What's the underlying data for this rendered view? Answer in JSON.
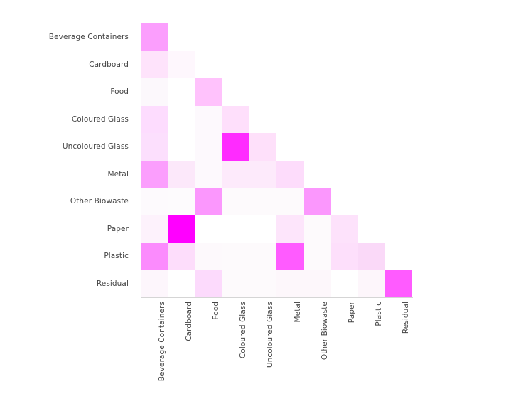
{
  "chart_data": {
    "type": "heatmap",
    "title": "",
    "xlabel": "",
    "ylabel": "",
    "grid": false,
    "legend": "none",
    "triangular": "lower",
    "colorscale": {
      "low": "#ffffff",
      "high": "#ff00ff",
      "name": "white-to-magenta"
    },
    "zmin": 0,
    "zmax": 100,
    "categories": [
      "Beverage Containers",
      "Cardboard",
      "Food",
      "Coloured Glass",
      "Uncoloured Glass",
      "Metal",
      "Other Biowaste",
      "Paper",
      "Plastic",
      "Residual"
    ],
    "x_tick_labels": [
      "Beverage Containers",
      "Cardboard",
      "Food",
      "Coloured Glass",
      "Uncoloured Glass",
      "Metal",
      "Other Biowaste",
      "Paper",
      "Plastic",
      "Residual"
    ],
    "y_tick_labels": [
      "Beverage Containers",
      "Cardboard",
      "Food",
      "Coloured Glass",
      "Uncoloured Glass",
      "Metal",
      "Other Biowaste",
      "Paper",
      "Plastic",
      "Residual"
    ],
    "rows": [
      {
        "label": "Beverage Containers",
        "values": [
          38,
          null,
          null,
          null,
          null,
          null,
          null,
          null,
          null,
          null
        ]
      },
      {
        "label": "Cardboard",
        "values": [
          11,
          3,
          null,
          null,
          null,
          null,
          null,
          null,
          null,
          null
        ]
      },
      {
        "label": "Food",
        "values": [
          3,
          0,
          24,
          null,
          null,
          null,
          null,
          null,
          null,
          null
        ]
      },
      {
        "label": "Coloured Glass",
        "values": [
          14,
          0,
          2,
          13,
          null,
          null,
          null,
          null,
          null,
          null
        ]
      },
      {
        "label": "Uncoloured Glass",
        "values": [
          13,
          0,
          2,
          83,
          12,
          null,
          null,
          null,
          null,
          null
        ]
      },
      {
        "label": "Metal",
        "values": [
          38,
          9,
          2,
          8,
          8,
          14,
          null,
          null,
          null,
          null
        ]
      },
      {
        "label": "Other Biowaste",
        "values": [
          3,
          2,
          40,
          3,
          3,
          3,
          41,
          null,
          null,
          null
        ]
      },
      {
        "label": "Paper",
        "values": [
          4,
          100,
          0,
          0,
          0,
          10,
          2,
          12,
          null,
          null
        ]
      },
      {
        "label": "Plastic",
        "values": [
          45,
          13,
          2,
          2,
          2,
          62,
          2,
          11,
          15,
          null
        ]
      },
      {
        "label": "Residual",
        "values": [
          3,
          0,
          15,
          2,
          2,
          3,
          3,
          0,
          3,
          64
        ]
      }
    ],
    "cell_colors": [
      [
        "#fb9efd",
        null,
        null,
        null,
        null,
        null,
        null,
        null,
        null,
        null
      ],
      [
        "#fee3fb",
        "#fef7fd",
        null,
        null,
        null,
        null,
        null,
        null,
        null,
        null
      ],
      [
        "#fcf8fc",
        "#ffffff",
        "#ffc2fc",
        null,
        null,
        null,
        null,
        null,
        null,
        null
      ],
      [
        "#fddcfe",
        "#ffffff",
        "#fdf9fd",
        "#fedffb",
        null,
        null,
        null,
        null,
        null,
        null
      ],
      [
        "#fcdffd",
        "#ffffff",
        "#fdf9fd",
        "#ff2bff",
        "#fee0fa",
        null,
        null,
        null,
        null,
        null
      ],
      [
        "#fb9efd",
        "#fce8fa",
        "#fdf9fd",
        "#fdeafb",
        "#fdeafb",
        "#fddcfb",
        null,
        null,
        null,
        null
      ],
      [
        "#fdfafd",
        "#fdfbfd",
        "#fb97fd",
        "#fdfafc",
        "#fdfafc",
        "#fdfafc",
        "#fb97fd",
        null,
        null,
        null
      ],
      [
        "#fdf2fc",
        "#ff00ff",
        "#ffffff",
        "#ffffff",
        "#ffffff",
        "#fde5fb",
        "#fdfafc",
        "#fde2fb",
        null,
        null
      ],
      [
        "#fb8bfd",
        "#fdddfb",
        "#fdf9fc",
        "#fdfafc",
        "#fdfafc",
        "#ff5bff",
        "#fdfafc",
        "#fddffb",
        "#fad9f8",
        null
      ],
      [
        "#fdf6fc",
        "#ffffff",
        "#fcdafc",
        "#fdfafc",
        "#fdfafc",
        "#fdf7fb",
        "#fdf7fb",
        "#ffffff",
        "#fdf6fb",
        "#ff5bff"
      ]
    ]
  },
  "axes": {
    "axis_line_color": "#d5d5d5",
    "tick_label_color": "#444444",
    "background_color": "#ffffff"
  }
}
